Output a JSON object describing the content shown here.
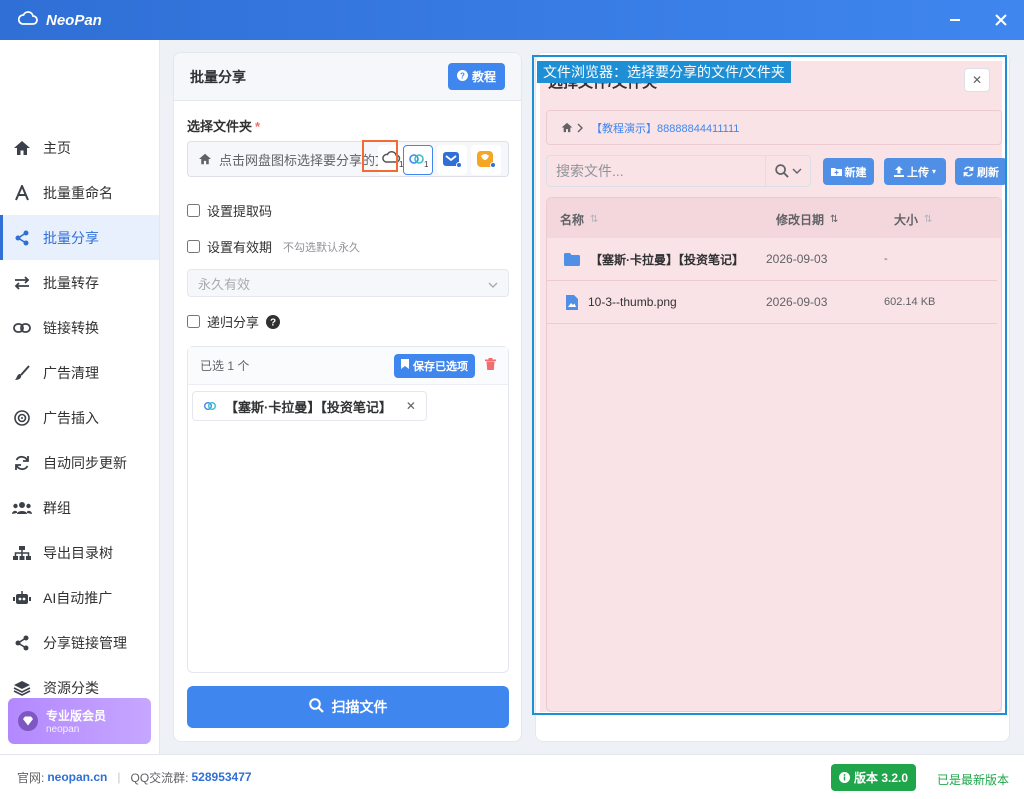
{
  "app": {
    "title": "NeoPan"
  },
  "sidebar": {
    "items": [
      {
        "label": "主页",
        "icon": "home-icon"
      },
      {
        "label": "批量重命名",
        "icon": "font-a-icon"
      },
      {
        "label": "批量分享",
        "icon": "share-icon",
        "active": true
      },
      {
        "label": "批量转存",
        "icon": "exchange-icon"
      },
      {
        "label": "链接转换",
        "icon": "link-icon"
      },
      {
        "label": "广告清理",
        "icon": "brush-icon"
      },
      {
        "label": "广告插入",
        "icon": "target-icon"
      },
      {
        "label": "自动同步更新",
        "icon": "sync-icon"
      },
      {
        "label": "群组",
        "icon": "users-icon"
      },
      {
        "label": "导出目录树",
        "icon": "sitemap-icon"
      },
      {
        "label": "AI自动推广",
        "icon": "robot-icon"
      },
      {
        "label": "分享链接管理",
        "icon": "share-nodes-icon"
      },
      {
        "label": "资源分类",
        "icon": "layers-icon"
      }
    ],
    "vip": {
      "title": "专业版会员",
      "subtitle": "neopan"
    }
  },
  "left_panel": {
    "title": "批量分享",
    "tutorial_label": "教程",
    "folder_label": "选择文件夹",
    "required_mark": "*",
    "folder_placeholder": "点击网盘图标选择要分享的文件夹",
    "disk_badge": "1",
    "extract_code_label": "设置提取码",
    "validity_label": "设置有效期",
    "validity_hint": "不勾选默认永久",
    "validity_select": "永久有效",
    "recursive_label": "递归分享",
    "selected_count": "已选 1 个",
    "save_selected_label": "保存已选项",
    "selected_items": [
      "【塞斯·卡拉曼】【投资笔记】"
    ],
    "scan_label": "扫描文件"
  },
  "file_browser": {
    "overlay_label": "文件浏览器：选择要分享的文件/文件夹",
    "title": "选择文件/文件夹",
    "breadcrumb": "【教程演示】88888844411111",
    "search_placeholder": "搜索文件...",
    "buttons": {
      "new": "新建",
      "upload": "上传",
      "refresh": "刷新"
    },
    "columns": {
      "name": "名称",
      "modified": "修改日期",
      "size": "大小"
    },
    "files": [
      {
        "name": "【塞斯·卡拉曼】【投资笔记】",
        "date": "2026-09-03",
        "size": "-",
        "type": "folder"
      },
      {
        "name": "10-3--thumb.png",
        "date": "2026-09-03",
        "size": "602.14 KB",
        "type": "image"
      }
    ]
  },
  "footer": {
    "site_label": "官网:",
    "site": "neopan.cn",
    "qq_label": "QQ交流群:",
    "qq": "528953477",
    "version": "版本 3.2.0",
    "status": "已是最新版本"
  },
  "colors": {
    "accent": "#3f86ef",
    "success": "#20a64a",
    "danger": "#f56c6c",
    "highlight": "#1e8fd4"
  }
}
